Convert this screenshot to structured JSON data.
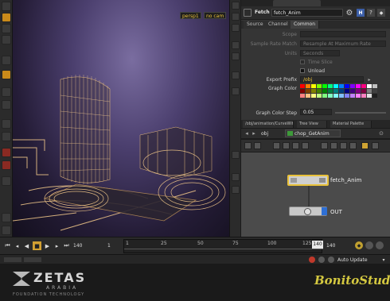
{
  "viewport": {
    "camera_menu": "persp1",
    "cam_menu": "no cam"
  },
  "param": {
    "node_type": "Fetch",
    "node_name": "fetch_Anim",
    "tabs": [
      "Source",
      "Channel",
      "Common"
    ],
    "active_tab": "Common",
    "scope_label": "Scope",
    "rate_label": "Sample Rate Match",
    "rate_value": "Resample At Maximum Rate",
    "units_label": "Units",
    "units_value": "Seconds",
    "timeslice_label": "Time Slice",
    "unload_label": "Unload",
    "prefix_label": "Export Prefix",
    "prefix_value": "/obj",
    "graph_color_label": "Graph Color",
    "step_label": "Graph Color Step",
    "step_value": "0.05"
  },
  "network": {
    "tabs": [
      "/obj/animation/CurveWith...",
      "Tree View",
      "Material Palette"
    ],
    "path": [
      "obj",
      "chop_GetAnim"
    ],
    "nodes": [
      {
        "label": "fetch_Anim",
        "state": "selected"
      },
      {
        "label": "OUT",
        "state": "output"
      }
    ]
  },
  "timeline": {
    "start_frame": "140",
    "range_start": "1",
    "ticks": [
      "1",
      "25",
      "50",
      "75",
      "100",
      "125"
    ],
    "current_frame": "140",
    "end_frame": "140",
    "end_field": "140"
  },
  "status": {
    "update_mode": "Auto Update"
  },
  "footer": {
    "brand": "ZETAS",
    "brand_sub": "ARABIA",
    "brand_tag": "FOUNDATION TECHNOLOGY",
    "watermark": "BonitoStudio"
  },
  "colors": {
    "accent": "#e8c13a",
    "node_selected": "#e8c13a",
    "output_flag": "#2e6fd4",
    "timeline_red": "#c0392b"
  },
  "palette_swatches": [
    "#ff0000",
    "#ff8000",
    "#ffff00",
    "#80ff00",
    "#00ff00",
    "#00ff80",
    "#00ffff",
    "#0080ff",
    "#0000ff",
    "#8000ff",
    "#ff00ff",
    "#ff0080",
    "#ffffff",
    "#c0c0c0",
    "#800000",
    "#804000",
    "#808000",
    "#408000",
    "#008000",
    "#008040",
    "#008080",
    "#004080",
    "#000080",
    "#400080",
    "#800080",
    "#800040",
    "#808080",
    "#404040",
    "#ff8080",
    "#ffc080",
    "#ffff80",
    "#c0ff80",
    "#80ff80",
    "#80ffc0",
    "#80ffff",
    "#80c0ff",
    "#8080ff",
    "#c080ff",
    "#ff80ff",
    "#ff80c0",
    "#e0e0e0",
    "#202020"
  ]
}
